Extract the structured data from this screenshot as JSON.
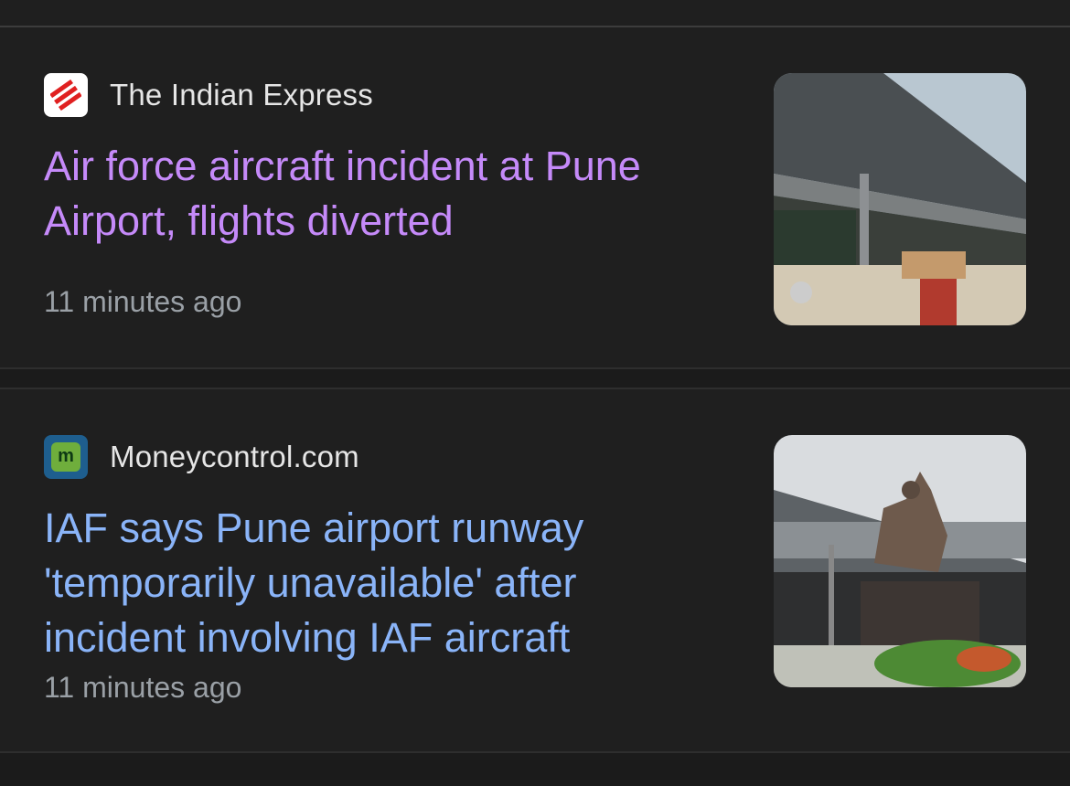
{
  "feed": {
    "items": [
      {
        "source": "The Indian Express",
        "icon": "indian-express-logo-icon",
        "headline": "Air force aircraft incident at Pune Airport, flights diverted",
        "time": "11 minutes ago",
        "visited": true,
        "thumbnail": "airport-terminal-photo"
      },
      {
        "source": "Moneycontrol.com",
        "icon": "moneycontrol-logo-icon",
        "favicon_letter": "m",
        "headline": "IAF says Pune airport runway 'temporarily unavailable' after incident involving IAF aircraft",
        "time": "11 minutes ago",
        "visited": false,
        "thumbnail": "airport-statue-photo"
      }
    ]
  },
  "colors": {
    "background": "#1f1f1f",
    "visited_link": "#c58af9",
    "link": "#8ab4f8",
    "timestamp": "#9aa0a6"
  }
}
